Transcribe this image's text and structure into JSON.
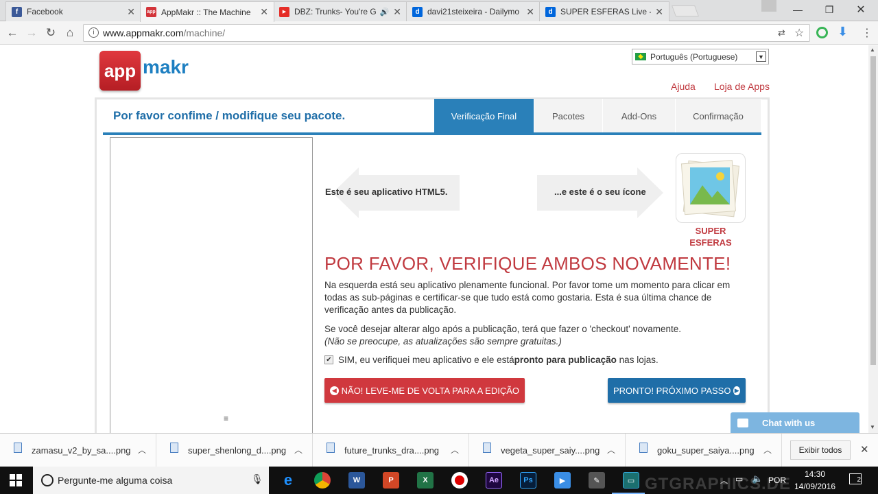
{
  "tabs": [
    {
      "title": "Facebook",
      "icon": "facebook-icon",
      "color": "#3b5998",
      "glyph": "f"
    },
    {
      "title": "AppMakr :: The Machine",
      "icon": "appmakr-icon",
      "color": "#d3343a",
      "glyph": "app"
    },
    {
      "title": "DBZ: Trunks- You're G",
      "icon": "youtube-icon",
      "color": "#e52d27",
      "glyph": "▶"
    },
    {
      "title": "davi21steixeira - Dailymo",
      "icon": "dailymotion-icon",
      "color": "#0066dc",
      "glyph": "d"
    },
    {
      "title": "SUPER ESFERAS Live - Vi",
      "icon": "dailymotion-icon",
      "color": "#0066dc",
      "glyph": "d"
    }
  ],
  "address": {
    "host": "www.appmakr.com",
    "path": "/machine/"
  },
  "logo": {
    "left": "app",
    "right": "makr"
  },
  "language": "Português (Portuguese)",
  "top_links": {
    "help": "Ajuda",
    "store": "Loja de Apps"
  },
  "panel_title": "Por favor confime / modifique seu pacote.",
  "steps": [
    "Verificação Final",
    "Pacotes",
    "Add-Ons",
    "Confirmação"
  ],
  "arrows": {
    "left": "Este é seu aplicativo HTML5.",
    "right": "...e este é o seu ícone"
  },
  "app_name": "SUPER ESFERAS",
  "heading": "POR FAVOR, VERIFIQUE AMBOS NOVAMENTE!",
  "paragraph1": "Na esquerda está seu aplicativo plenamente funcional. Por favor tome um momento para clicar em todas as sub-páginas e certificar-se que tudo está como gostaria. Esta é sua última chance de verificação antes da publicação.",
  "paragraph2": "Se você desejar alterar algo após a publicação, terá que fazer o 'checkout' novamente.",
  "paragraph2_italic": "(Não se preocupe, as atualizações são sempre gratuitas.)",
  "confirm": {
    "pre": "SIM, eu verifiquei meu aplicativo e ele está ",
    "bold": "pronto para publicação",
    "post": " nas lojas.",
    "checked": true
  },
  "buttons": {
    "back": "NÃO! LEVE-ME DE VOLTA PARA A EDIÇÃO",
    "next": "PRONTO! PRÓXIMO PASSO"
  },
  "chat": "Chat with us",
  "downloads": [
    "zamasu_v2_by_sa....png",
    "super_shenlong_d....png",
    "future_trunks_dra....png",
    "vegeta_super_saiy....png",
    "goku_super_saiya....png"
  ],
  "show_all": "Exibir todos",
  "taskbar": {
    "search": "Pergunte-me alguma coisa",
    "lang": "POR",
    "time": "14:30",
    "date": "14/09/2016",
    "notifications": "2",
    "watermark": "GTGRAPHICS.DE"
  },
  "colors": {
    "accent": "#2a80b9",
    "brand_red": "#c0393f"
  }
}
